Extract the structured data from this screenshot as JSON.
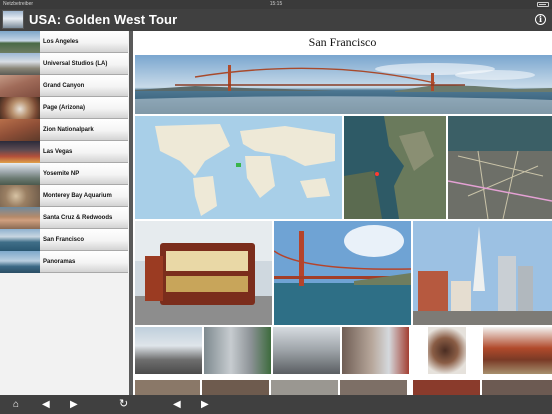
{
  "status_bar": {
    "carrier": "Netzbetreiber",
    "time": "15:15"
  },
  "header": {
    "title": "USA: Golden West Tour",
    "app_icon": "panorama-thumbnail-icon",
    "info_icon": "info-icon"
  },
  "sidebar": {
    "items": [
      {
        "label": "Los Angeles"
      },
      {
        "label": "Universal Studios (LA)"
      },
      {
        "label": "Grand Canyon"
      },
      {
        "label": "Page (Arizona)"
      },
      {
        "label": "Zion Nationalpark"
      },
      {
        "label": "Las Vegas"
      },
      {
        "label": "Yosemite NP"
      },
      {
        "label": "Monterey Bay Aquarium"
      },
      {
        "label": "Santa Cruz & Redwoods"
      },
      {
        "label": "San Francisco"
      },
      {
        "label": "Panoramas"
      }
    ],
    "selected": "San Francisco"
  },
  "main": {
    "heading": "San Francisco"
  },
  "toolbar_left": {
    "home_icon": "home-icon",
    "back_icon": "triangle-left-icon",
    "forward_icon": "triangle-right-icon",
    "reload_icon": "reload-icon"
  },
  "toolbar_right": {
    "back_icon": "triangle-left-icon",
    "forward_icon": "triangle-right-icon"
  },
  "colors": {
    "bar_background": "#404040",
    "status_background": "#3a3a3a",
    "sidebar_background": "#f2f2f2",
    "content_background": "#ffffff"
  }
}
